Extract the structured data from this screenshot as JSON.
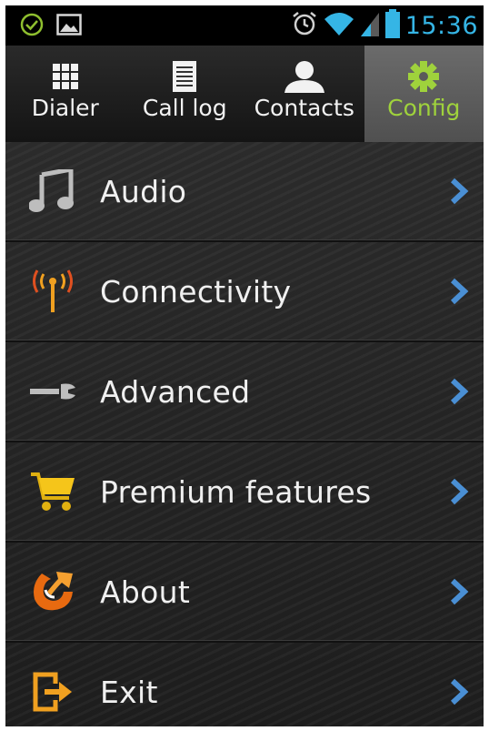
{
  "status_bar": {
    "time": "15:36",
    "time_color": "#35b5e5",
    "icons": [
      "check-circle-icon",
      "image-icon",
      "alarm-icon",
      "wifi-icon",
      "signal-icon",
      "battery-icon"
    ]
  },
  "tabs": [
    {
      "label": "Dialer",
      "icon": "dialpad-icon",
      "active": false
    },
    {
      "label": "Call log",
      "icon": "list-icon",
      "active": false
    },
    {
      "label": "Contacts",
      "icon": "person-icon",
      "active": false
    },
    {
      "label": "Config",
      "icon": "gear-icon",
      "active": true
    }
  ],
  "active_tab_color": "#9fd23c",
  "menu": {
    "items": [
      {
        "label": "Audio",
        "icon": "music-note-icon"
      },
      {
        "label": "Connectivity",
        "icon": "antenna-icon"
      },
      {
        "label": "Advanced",
        "icon": "wrench-icon"
      },
      {
        "label": "Premium features",
        "icon": "cart-icon"
      },
      {
        "label": "About",
        "icon": "app-logo-icon"
      },
      {
        "label": "Exit",
        "icon": "exit-icon"
      }
    ]
  },
  "chevron_color": "#4a8fd4"
}
